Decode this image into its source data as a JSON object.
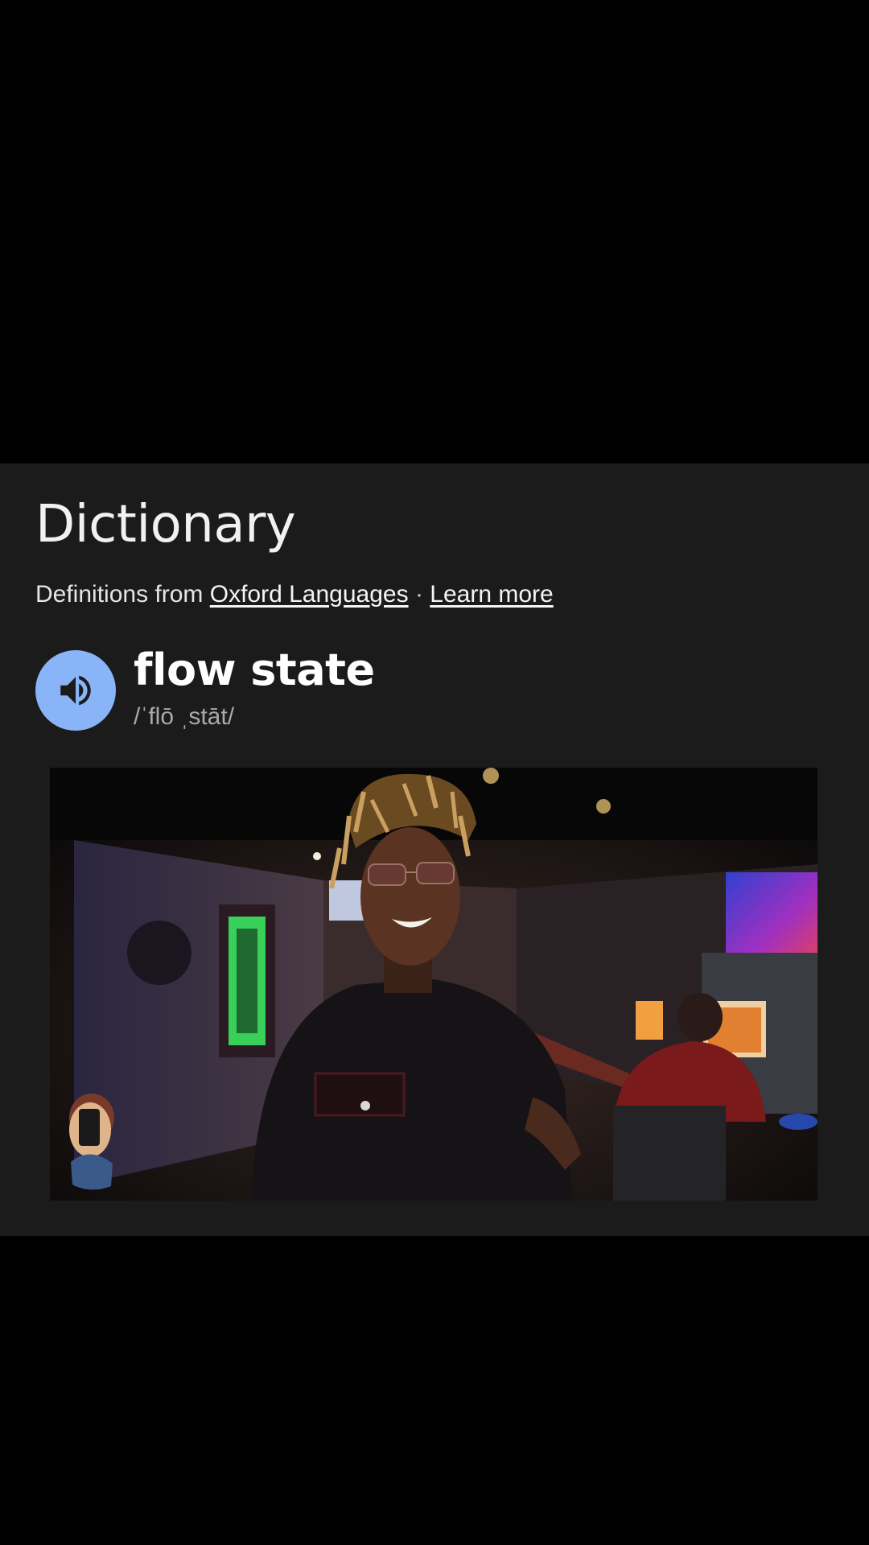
{
  "dictionary": {
    "title": "Dictionary",
    "source_prefix": "Definitions from",
    "source_link": "Oxford Languages",
    "separator": "·",
    "learn_more": "Learn more"
  },
  "entry": {
    "word": "flow state",
    "pronunciation": "/ˈflō ˌstāt/",
    "audio_icon": "speaker-icon"
  },
  "colors": {
    "card_background": "#1b1b1c",
    "accent": "#8ab4f8",
    "page_background": "#000000"
  }
}
